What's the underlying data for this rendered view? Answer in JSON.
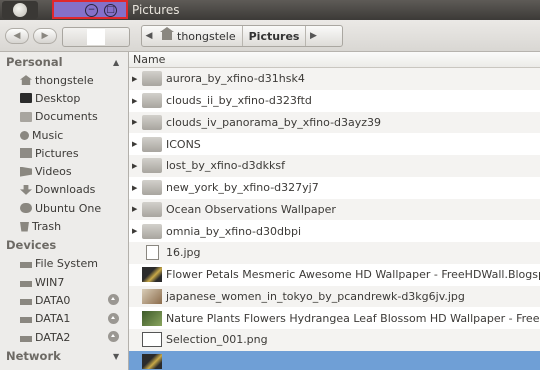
{
  "window": {
    "title": "Pictures"
  },
  "breadcrumb": [
    {
      "label": "thongstele",
      "icon": "home-icon"
    },
    {
      "label": "Pictures",
      "active": true
    }
  ],
  "sidebar": {
    "sections": [
      {
        "label": "Personal",
        "items": [
          {
            "label": "thongstele",
            "icon": "home-icon"
          },
          {
            "label": "Desktop",
            "icon": "desktop-icon"
          },
          {
            "label": "Documents",
            "icon": "documents-icon"
          },
          {
            "label": "Music",
            "icon": "music-icon"
          },
          {
            "label": "Pictures",
            "icon": "pictures-icon"
          },
          {
            "label": "Videos",
            "icon": "videos-icon"
          },
          {
            "label": "Downloads",
            "icon": "downloads-icon"
          },
          {
            "label": "Ubuntu One",
            "icon": "ubuntu-one-icon"
          },
          {
            "label": "Trash",
            "icon": "trash-icon"
          }
        ]
      },
      {
        "label": "Devices",
        "items": [
          {
            "label": "File System",
            "icon": "drive-icon"
          },
          {
            "label": "WIN7",
            "icon": "drive-icon"
          },
          {
            "label": "DATA0",
            "icon": "drive-icon",
            "eject": true
          },
          {
            "label": "DATA1",
            "icon": "drive-icon",
            "eject": true
          },
          {
            "label": "DATA2",
            "icon": "drive-icon",
            "eject": true
          }
        ]
      },
      {
        "label": "Network",
        "items": []
      }
    ]
  },
  "list": {
    "column_header": "Name",
    "rows": [
      {
        "name": "aurora_by_xfino-d31hsk4",
        "type": "folder",
        "expandable": true
      },
      {
        "name": "clouds_ii_by_xfino-d323ftd",
        "type": "folder",
        "expandable": true
      },
      {
        "name": "clouds_iv_panorama_by_xfino-d3ayz39",
        "type": "folder",
        "expandable": true
      },
      {
        "name": "ICONS",
        "type": "folder",
        "expandable": true
      },
      {
        "name": "lost_by_xfino-d3dkksf",
        "type": "folder",
        "expandable": true
      },
      {
        "name": "new_york_by_xfino-d327yj7",
        "type": "folder",
        "expandable": true
      },
      {
        "name": "Ocean Observations Wallpaper",
        "type": "folder",
        "expandable": true
      },
      {
        "name": "omnia_by_xfino-d30dbpi",
        "type": "folder",
        "expandable": true
      },
      {
        "name": "16.jpg",
        "type": "file",
        "expandable": false
      },
      {
        "name": "Flower Petals Mesmeric Awesome HD Wallpaper - FreeHDWall.Blogspot",
        "type": "thumb1",
        "expandable": false
      },
      {
        "name": "japanese_women_in_tokyo_by_pcandrewk-d3kg6jv.jpg",
        "type": "thumb2",
        "expandable": false
      },
      {
        "name": "Nature Plants Flowers Hydrangea Leaf Blossom HD Wallpaper - FreeHD",
        "type": "thumb3",
        "expandable": false
      },
      {
        "name": "Selection_001.png",
        "type": "thumb4",
        "expandable": false
      },
      {
        "name": "",
        "type": "thumb1",
        "expandable": false,
        "selected": true
      }
    ]
  }
}
